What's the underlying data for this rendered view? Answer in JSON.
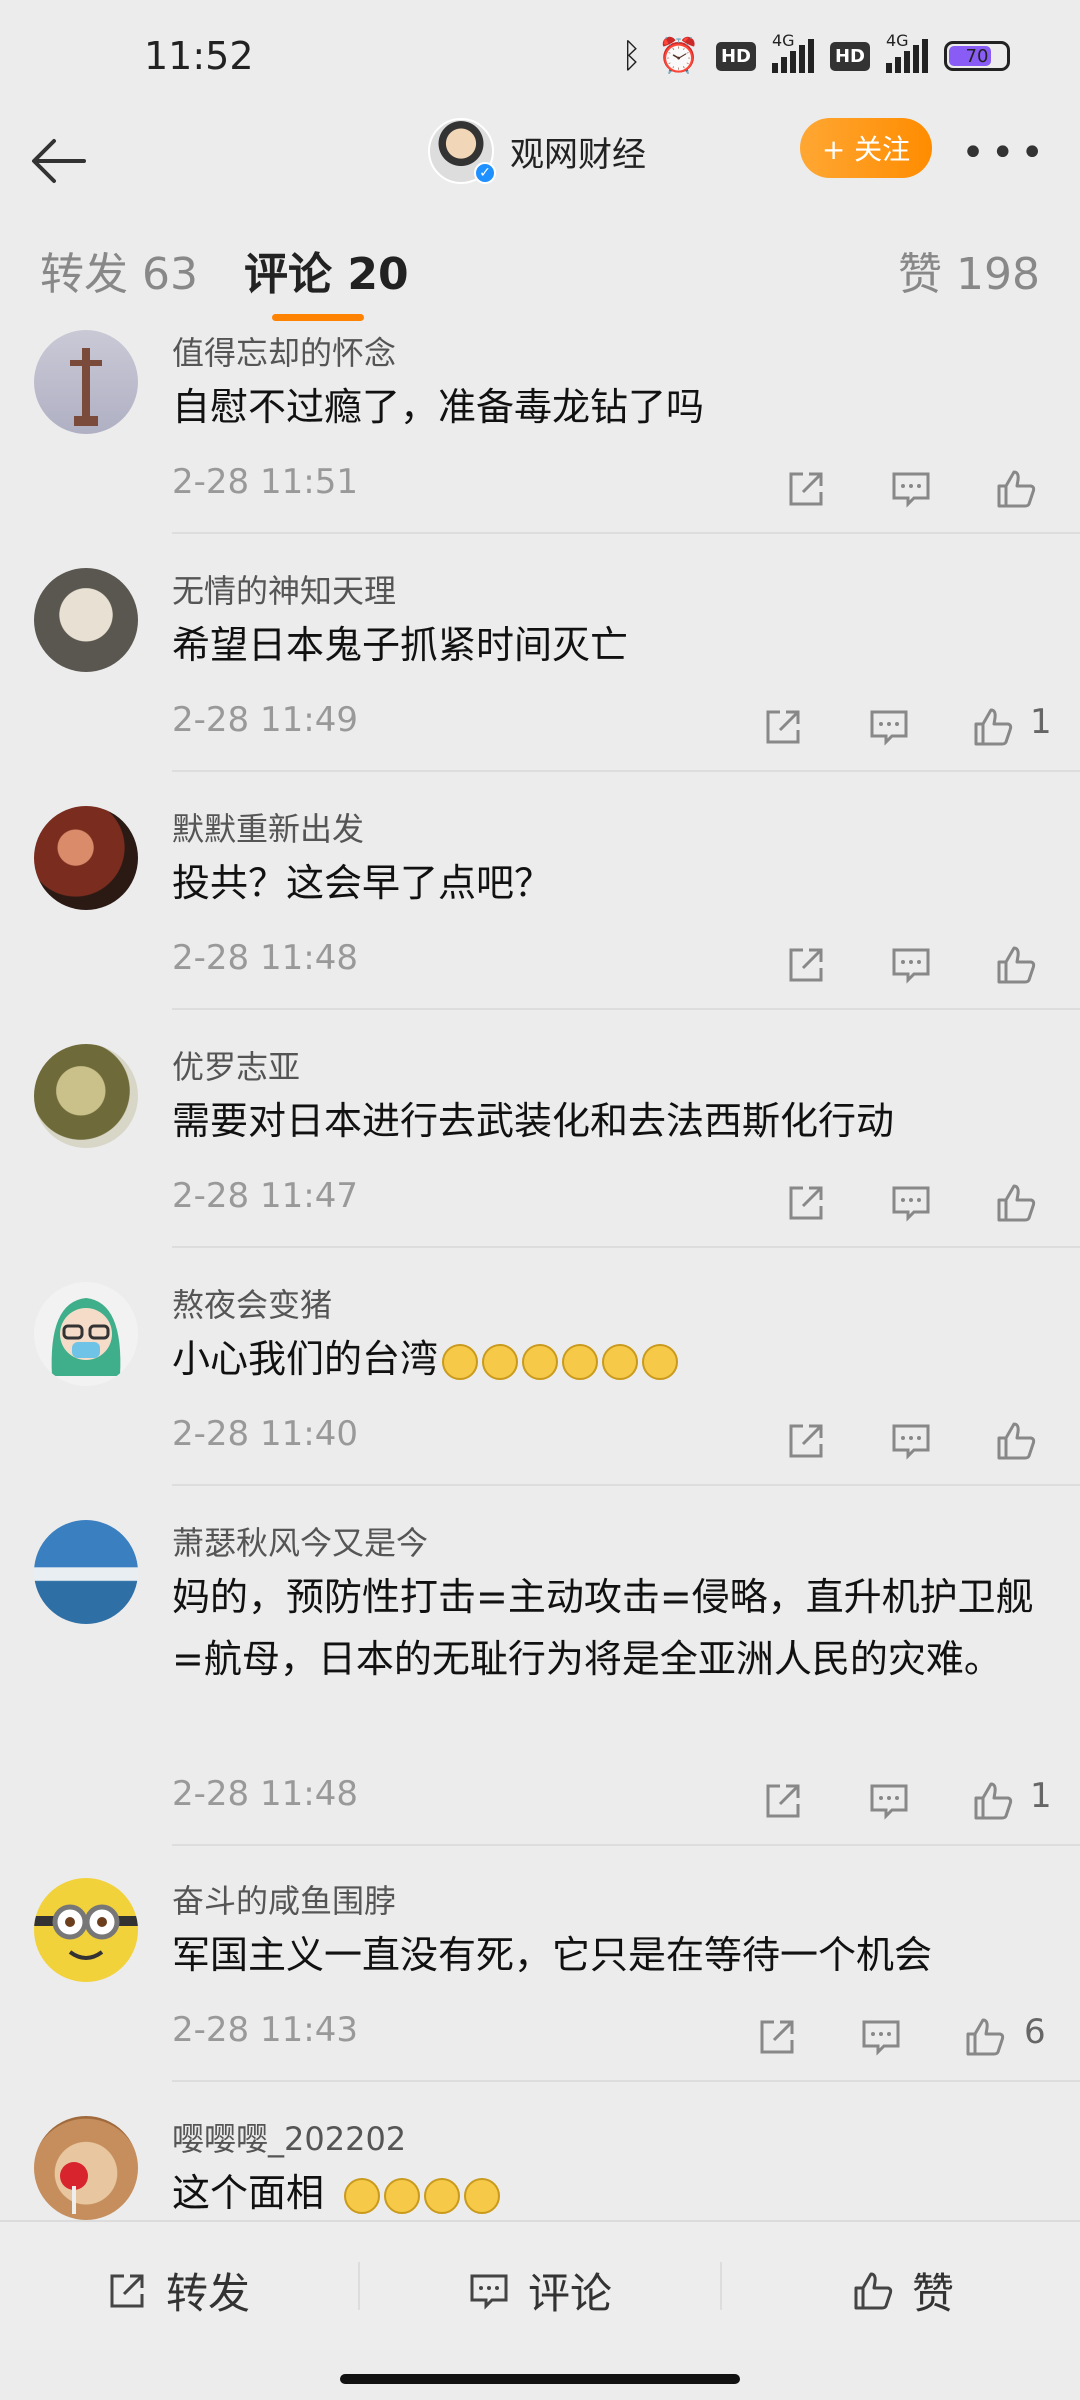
{
  "status": {
    "time": "11:52",
    "battery": "70",
    "net1": "4G",
    "net2": "4G",
    "hd": "HD"
  },
  "header": {
    "title": "观网财经",
    "follow_label": "+ 关注",
    "more": "•••"
  },
  "tabs": {
    "repost_label": "转发",
    "repost_count": "63",
    "comment_label": "评论",
    "comment_count": "20",
    "like_label": "赞",
    "like_count": "198"
  },
  "comments": [
    {
      "user": "值得忘却的怀念",
      "text": "自慰不过瘾了，准备毒龙钻了吗",
      "time": "2-28 11:51",
      "likes": ""
    },
    {
      "user": "无情的神知天理",
      "text": "希望日本鬼子抓紧时间灭亡",
      "time": "2-28 11:49",
      "likes": "1"
    },
    {
      "user": "默默重新出发",
      "text": "投共？这会早了点吧？",
      "time": "2-28 11:48",
      "likes": ""
    },
    {
      "user": "优罗志亚",
      "text": "需要对日本进行去武装化和去法西斯化行动",
      "time": "2-28 11:47",
      "likes": ""
    },
    {
      "user": "熬夜会变猪",
      "text": "小心我们的台湾",
      "time": "2-28 11:40",
      "likes": ""
    },
    {
      "user": "萧瑟秋风今又是今",
      "text": "妈的，预防性打击=主动攻击=侵略，直升机护卫舰=航母，日本的无耻行为将是全亚洲人民的灾难。",
      "time": "2-28 11:48",
      "likes": "1"
    },
    {
      "user": "奋斗的咸鱼围脖",
      "text": "军国主义一直没有死，它只是在等待一个机会",
      "time": "2-28 11:43",
      "likes": "6"
    },
    {
      "user": "嘤嘤嘤_202202",
      "text": "这个面相",
      "time": "",
      "likes": ""
    }
  ],
  "bottom": {
    "repost": "转发",
    "comment": "评论",
    "like": "赞"
  },
  "colors": {
    "accent": "#ff8200",
    "follow": "#ff9a1f",
    "verify": "#1e90ff"
  },
  "icons": [
    "back-arrow-icon",
    "share-icon",
    "comment-icon",
    "thumb-up-icon",
    "bluetooth-icon",
    "alarm-icon"
  ]
}
